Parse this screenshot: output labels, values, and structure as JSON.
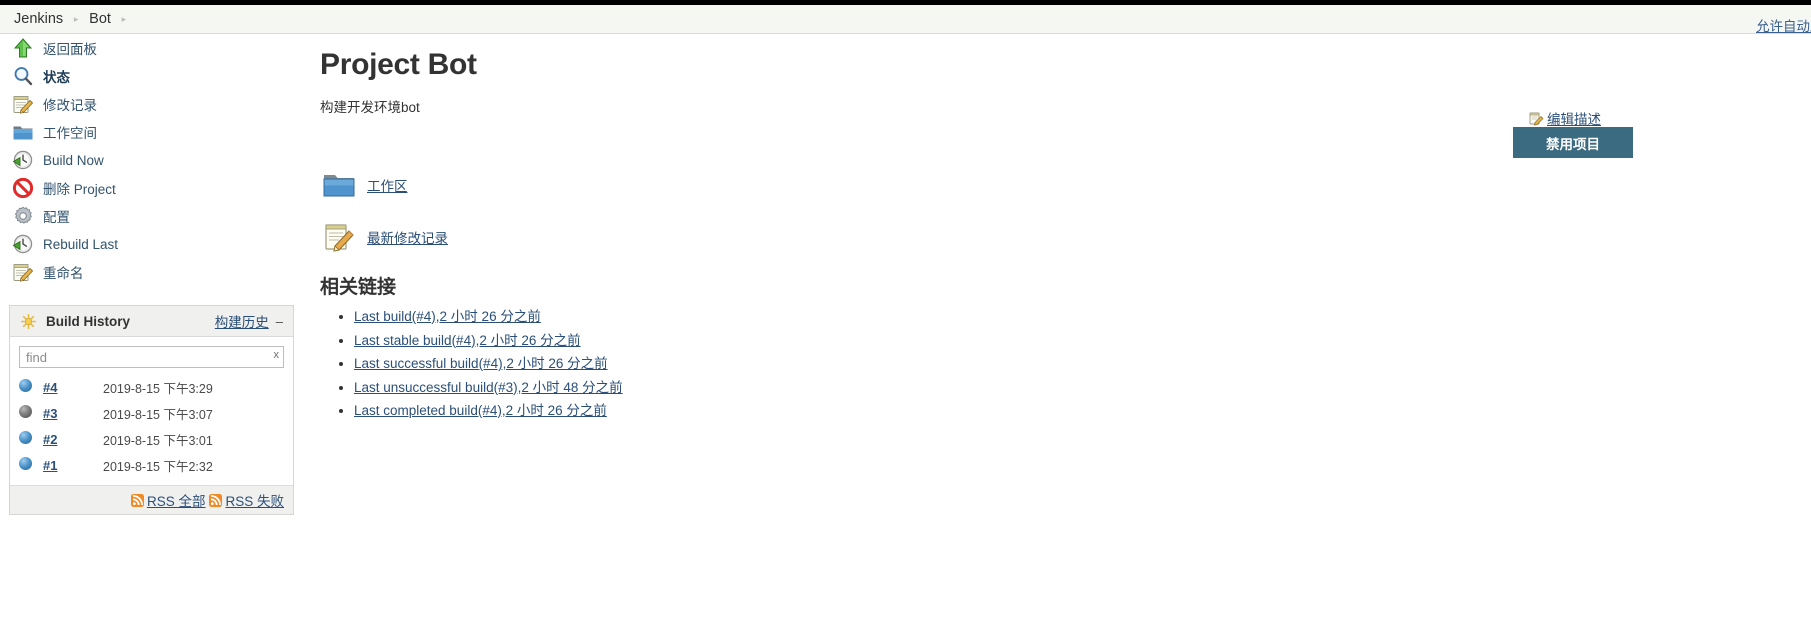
{
  "breadcrumb": {
    "items": [
      {
        "label": "Jenkins"
      },
      {
        "label": "Bot"
      }
    ],
    "separator": "▸",
    "autorefresh_label": "允许自动刷新"
  },
  "sidebar": {
    "items": [
      {
        "label": "返回面板",
        "icon": "up-arrow-icon",
        "active": false
      },
      {
        "label": "状态",
        "icon": "magnifier-icon",
        "active": true
      },
      {
        "label": "修改记录",
        "icon": "notepad-pencil-icon",
        "active": false
      },
      {
        "label": "工作空间",
        "icon": "folder-icon",
        "active": false
      },
      {
        "label": "Build Now",
        "icon": "build-clock-icon",
        "active": false
      },
      {
        "label": "删除 Project",
        "icon": "delete-forbidden-icon",
        "active": false
      },
      {
        "label": "配置",
        "icon": "gear-icon",
        "active": false
      },
      {
        "label": "Rebuild Last",
        "icon": "build-clock-icon",
        "active": false
      },
      {
        "label": "重命名",
        "icon": "notepad-pencil-icon",
        "active": false
      }
    ]
  },
  "build_history": {
    "title": "Build History",
    "link_label": "构建历史",
    "collapse_glyph": "–",
    "sun_icon": "sun-icon",
    "find": {
      "value": "",
      "placeholder": "find",
      "clear_label": "x"
    },
    "builds": [
      {
        "status": "blue",
        "number": "#4",
        "time": "2019-8-15 下午3:29"
      },
      {
        "status": "grey",
        "number": "#3",
        "time": "2019-8-15 下午3:07"
      },
      {
        "status": "blue",
        "number": "#2",
        "time": "2019-8-15 下午3:01"
      },
      {
        "status": "blue",
        "number": "#1",
        "time": "2019-8-15 下午2:32"
      }
    ],
    "rss": [
      {
        "label": "RSS 全部",
        "icon": "rss-icon"
      },
      {
        "label": "RSS 失败",
        "icon": "rss-icon"
      }
    ]
  },
  "main": {
    "title": "Project Bot",
    "description": "构建开发环境bot",
    "links": [
      {
        "label": "工作区",
        "icon": "folder-icon"
      },
      {
        "label": "最新修改记录",
        "icon": "notepad-pencil-icon"
      }
    ],
    "related": {
      "heading": "相关链接",
      "items": [
        {
          "label": "Last build(#4),2 小时 26 分之前"
        },
        {
          "label": "Last stable build(#4),2 小时 26 分之前"
        },
        {
          "label": "Last successful build(#4),2 小时 26 分之前"
        },
        {
          "label": "Last unsuccessful build(#3),2 小时 48 分之前"
        },
        {
          "label": "Last completed build(#4),2 小时 26 分之前"
        }
      ]
    }
  },
  "right_rail": {
    "edit_description_label": "编辑描述",
    "edit_icon": "edit-note-icon",
    "disable_project_label": "禁用项目"
  },
  "colors": {
    "link": "#2b4f78",
    "button_bg": "#3a6b80",
    "breadcrumb_bg": "#f5f7f3",
    "panel_header_bg": "#f0f0ef"
  }
}
